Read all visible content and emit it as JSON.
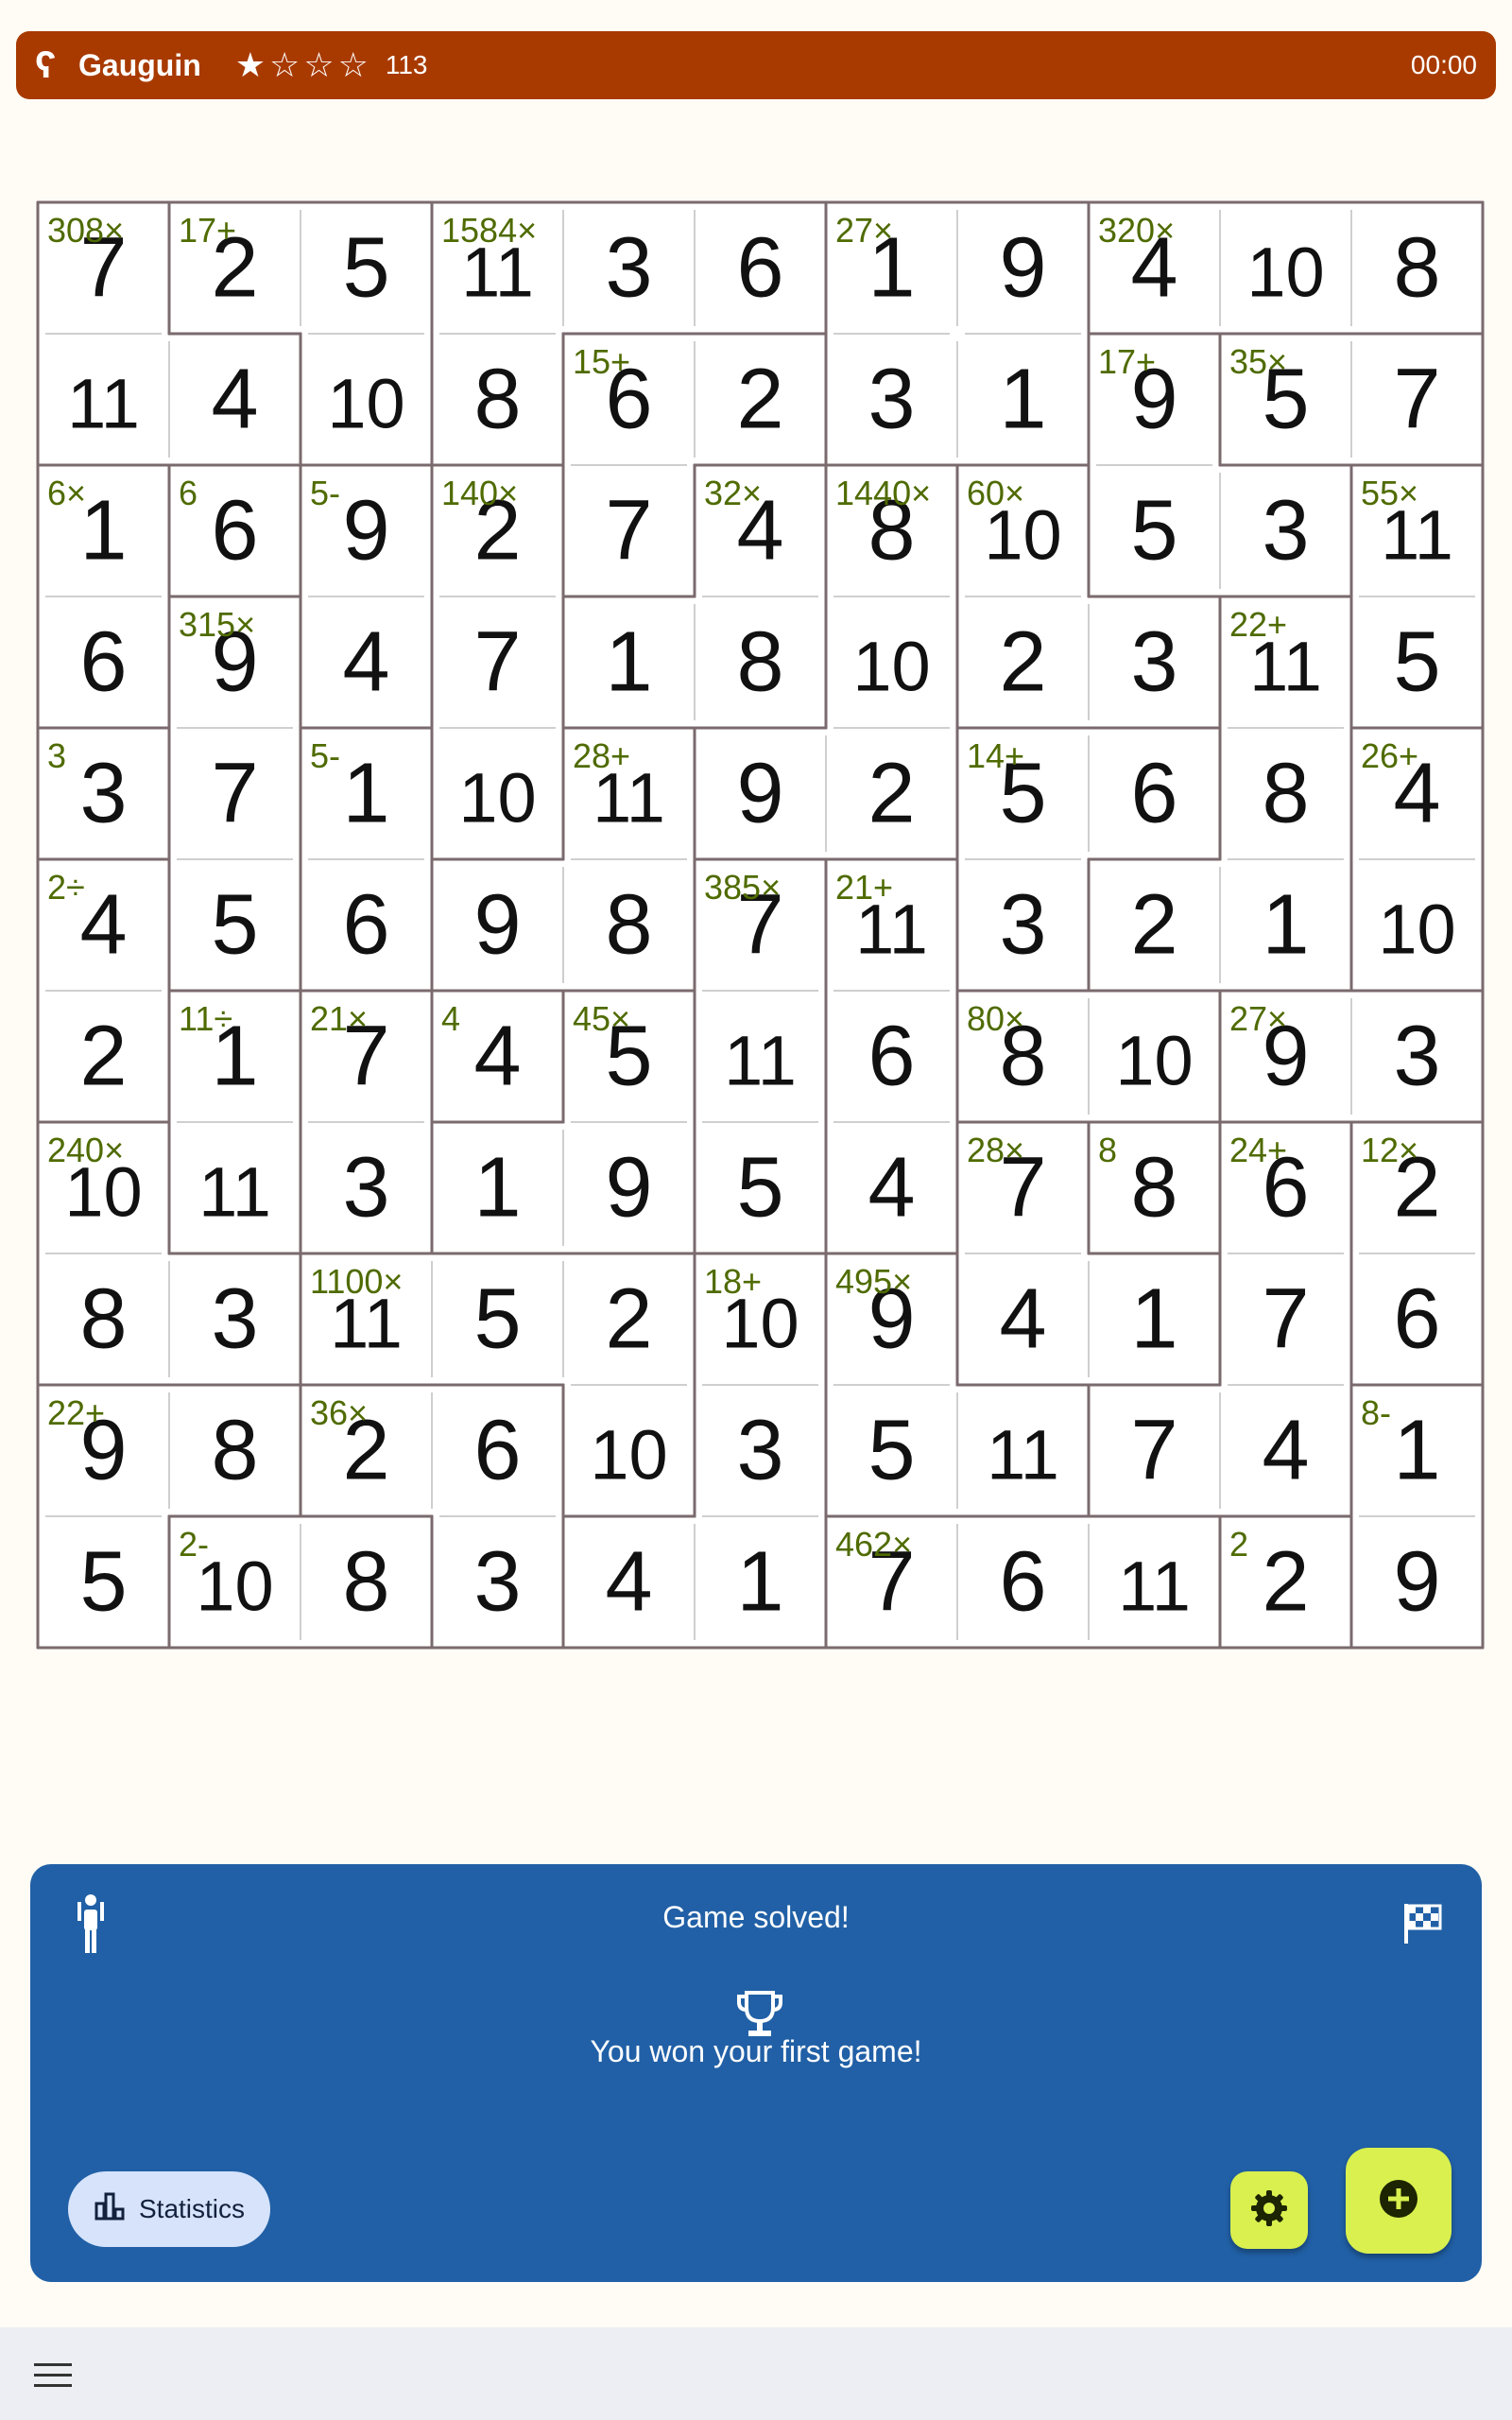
{
  "header": {
    "app_title": "Gauguin",
    "stars_display": "★☆☆☆",
    "difficulty_value": 113,
    "timer": "00:00"
  },
  "grid": {
    "size": 11,
    "values": [
      [
        7,
        2,
        5,
        11,
        3,
        6,
        1,
        9,
        4,
        10,
        8
      ],
      [
        11,
        4,
        10,
        8,
        6,
        2,
        3,
        1,
        9,
        5,
        7
      ],
      [
        1,
        6,
        9,
        2,
        7,
        4,
        8,
        10,
        5,
        3,
        11
      ],
      [
        6,
        9,
        4,
        7,
        1,
        8,
        10,
        2,
        3,
        11,
        5
      ],
      [
        3,
        7,
        1,
        10,
        11,
        9,
        2,
        5,
        6,
        8,
        4
      ],
      [
        4,
        5,
        6,
        9,
        8,
        7,
        11,
        3,
        2,
        1,
        10
      ],
      [
        2,
        1,
        7,
        4,
        5,
        11,
        6,
        8,
        10,
        9,
        3
      ],
      [
        10,
        11,
        3,
        1,
        9,
        5,
        4,
        7,
        8,
        6,
        2
      ],
      [
        8,
        3,
        11,
        5,
        2,
        10,
        9,
        4,
        1,
        7,
        6
      ],
      [
        9,
        8,
        2,
        6,
        10,
        3,
        5,
        11,
        7,
        4,
        1
      ],
      [
        5,
        10,
        8,
        3,
        4,
        1,
        7,
        6,
        11,
        2,
        9
      ]
    ],
    "cages": [
      {
        "label": "308×",
        "cells": [
          [
            0,
            0
          ],
          [
            1,
            0
          ],
          [
            1,
            1
          ]
        ]
      },
      {
        "label": "17+",
        "cells": [
          [
            0,
            1
          ],
          [
            0,
            2
          ],
          [
            1,
            2
          ]
        ]
      },
      {
        "label": "1584×",
        "cells": [
          [
            0,
            3
          ],
          [
            0,
            4
          ],
          [
            0,
            5
          ],
          [
            1,
            3
          ]
        ]
      },
      {
        "label": "27×",
        "cells": [
          [
            0,
            6
          ],
          [
            0,
            7
          ],
          [
            1,
            6
          ],
          [
            1,
            7
          ]
        ]
      },
      {
        "label": "320×",
        "cells": [
          [
            0,
            8
          ],
          [
            0,
            9
          ],
          [
            0,
            10
          ]
        ]
      },
      {
        "label": "15+",
        "cells": [
          [
            1,
            4
          ],
          [
            1,
            5
          ],
          [
            2,
            4
          ]
        ]
      },
      {
        "label": "17+",
        "cells": [
          [
            1,
            8
          ],
          [
            2,
            8
          ],
          [
            2,
            9
          ]
        ]
      },
      {
        "label": "35×",
        "cells": [
          [
            1,
            9
          ],
          [
            1,
            10
          ]
        ]
      },
      {
        "label": "6×",
        "cells": [
          [
            2,
            0
          ],
          [
            3,
            0
          ]
        ]
      },
      {
        "label": "6",
        "cells": [
          [
            2,
            1
          ]
        ]
      },
      {
        "label": "5-",
        "cells": [
          [
            2,
            2
          ],
          [
            3,
            2
          ]
        ]
      },
      {
        "label": "140×",
        "cells": [
          [
            2,
            3
          ],
          [
            3,
            3
          ],
          [
            4,
            3
          ]
        ]
      },
      {
        "label": "32×",
        "cells": [
          [
            2,
            5
          ],
          [
            3,
            4
          ],
          [
            3,
            5
          ]
        ]
      },
      {
        "label": "1440×",
        "cells": [
          [
            2,
            6
          ],
          [
            3,
            6
          ],
          [
            4,
            6
          ],
          [
            4,
            5
          ]
        ]
      },
      {
        "label": "60×",
        "cells": [
          [
            2,
            7
          ],
          [
            3,
            7
          ],
          [
            3,
            8
          ]
        ]
      },
      {
        "label": "55×",
        "cells": [
          [
            2,
            10
          ],
          [
            3,
            10
          ]
        ]
      },
      {
        "label": "315×",
        "cells": [
          [
            3,
            1
          ],
          [
            4,
            1
          ],
          [
            5,
            1
          ]
        ]
      },
      {
        "label": "22+",
        "cells": [
          [
            3,
            9
          ],
          [
            4,
            9
          ],
          [
            5,
            9
          ],
          [
            5,
            8
          ]
        ]
      },
      {
        "label": "3",
        "cells": [
          [
            4,
            0
          ]
        ]
      },
      {
        "label": "5-",
        "cells": [
          [
            4,
            2
          ],
          [
            5,
            2
          ]
        ]
      },
      {
        "label": "28+",
        "cells": [
          [
            4,
            4
          ],
          [
            5,
            3
          ],
          [
            5,
            4
          ]
        ]
      },
      {
        "label": "14+",
        "cells": [
          [
            4,
            7
          ],
          [
            4,
            8
          ],
          [
            5,
            7
          ]
        ]
      },
      {
        "label": "26+",
        "cells": [
          [
            4,
            10
          ],
          [
            5,
            10
          ]
        ]
      },
      {
        "label": "2÷",
        "cells": [
          [
            5,
            0
          ],
          [
            6,
            0
          ]
        ]
      },
      {
        "label": "385×",
        "cells": [
          [
            5,
            5
          ],
          [
            6,
            5
          ],
          [
            7,
            5
          ]
        ]
      },
      {
        "label": "21+",
        "cells": [
          [
            5,
            6
          ],
          [
            6,
            6
          ],
          [
            7,
            6
          ]
        ]
      },
      {
        "label": "11÷",
        "cells": [
          [
            6,
            1
          ],
          [
            7,
            1
          ]
        ]
      },
      {
        "label": "21×",
        "cells": [
          [
            6,
            2
          ],
          [
            7,
            2
          ]
        ]
      },
      {
        "label": "4",
        "cells": [
          [
            6,
            3
          ]
        ]
      },
      {
        "label": "45×",
        "cells": [
          [
            6,
            4
          ],
          [
            7,
            3
          ],
          [
            7,
            4
          ]
        ]
      },
      {
        "label": "80×",
        "cells": [
          [
            6,
            7
          ],
          [
            6,
            8
          ]
        ]
      },
      {
        "label": "27×",
        "cells": [
          [
            6,
            9
          ],
          [
            6,
            10
          ]
        ]
      },
      {
        "label": "240×",
        "cells": [
          [
            7,
            0
          ],
          [
            8,
            0
          ],
          [
            8,
            1
          ]
        ]
      },
      {
        "label": "28×",
        "cells": [
          [
            7,
            7
          ],
          [
            8,
            7
          ],
          [
            8,
            8
          ]
        ]
      },
      {
        "label": "8",
        "cells": [
          [
            7,
            8
          ]
        ]
      },
      {
        "label": "24+",
        "cells": [
          [
            7,
            9
          ],
          [
            8,
            9
          ],
          [
            9,
            9
          ],
          [
            9,
            8
          ]
        ]
      },
      {
        "label": "12×",
        "cells": [
          [
            7,
            10
          ],
          [
            8,
            10
          ]
        ]
      },
      {
        "label": "1100×",
        "cells": [
          [
            8,
            2
          ],
          [
            8,
            3
          ],
          [
            8,
            4
          ],
          [
            9,
            4
          ]
        ]
      },
      {
        "label": "18+",
        "cells": [
          [
            8,
            5
          ],
          [
            9,
            5
          ],
          [
            10,
            5
          ],
          [
            10,
            4
          ]
        ]
      },
      {
        "label": "495×",
        "cells": [
          [
            8,
            6
          ],
          [
            9,
            6
          ],
          [
            9,
            7
          ]
        ]
      },
      {
        "label": "22+",
        "cells": [
          [
            9,
            0
          ],
          [
            9,
            1
          ],
          [
            10,
            0
          ]
        ]
      },
      {
        "label": "36×",
        "cells": [
          [
            9,
            2
          ],
          [
            9,
            3
          ],
          [
            10,
            3
          ]
        ]
      },
      {
        "label": "8-",
        "cells": [
          [
            9,
            10
          ],
          [
            10,
            10
          ]
        ]
      },
      {
        "label": "2-",
        "cells": [
          [
            10,
            1
          ],
          [
            10,
            2
          ]
        ]
      },
      {
        "label": "462×",
        "cells": [
          [
            10,
            6
          ],
          [
            10,
            7
          ],
          [
            10,
            8
          ]
        ]
      },
      {
        "label": "2",
        "cells": [
          [
            10,
            9
          ]
        ]
      }
    ]
  },
  "colors": {
    "header_bg": "#a83a00",
    "background": "#fffcf6",
    "cage_border": "#7a6a6e",
    "inner_line": "#cfcfcf",
    "digit": "#111111",
    "cage_label": "#4f6b00",
    "panel_bg": "#2160a6",
    "accent_button": "#d9f04f",
    "stats_button": "#d6e3fb",
    "navbar": "#eceef4"
  },
  "panel": {
    "title": "Game solved!",
    "message": "You won your first game!",
    "statistics_label": "Statistics",
    "icons": {
      "left": "person-icon",
      "right": "flag-icon",
      "center": "trophy-icon",
      "stats": "bar-chart-icon",
      "settings": "gear-icon",
      "new_game": "plus-circle-icon",
      "menu": "menu-icon"
    }
  }
}
